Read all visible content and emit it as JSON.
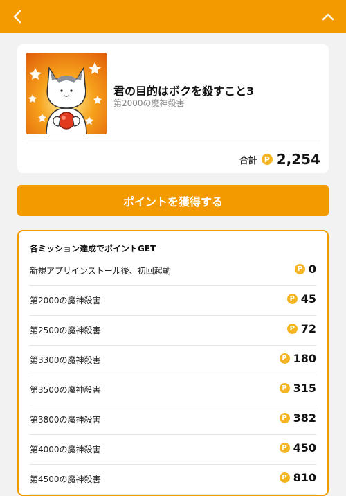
{
  "header": {
    "back_icon": "chevron-left-icon",
    "collapse_icon": "chevron-up-icon",
    "color": "#f39a00"
  },
  "app": {
    "title": "君の目的はボクを殺すこと3",
    "subtitle": "第2000の魔神殺害",
    "total_label": "合計",
    "total_value": "2,254",
    "coin_symbol": "P"
  },
  "cta": {
    "label": "ポイントを獲得する"
  },
  "missions": {
    "heading": "各ミッション達成でポイントGET",
    "items": [
      {
        "label": "新規アプリインストール後、初回起動",
        "points": "0"
      },
      {
        "label": "第2000の魔神殺害",
        "points": "45"
      },
      {
        "label": "第2500の魔神殺害",
        "points": "72"
      },
      {
        "label": "第3300の魔神殺害",
        "points": "180"
      },
      {
        "label": "第3500の魔神殺害",
        "points": "315"
      },
      {
        "label": "第3800の魔神殺害",
        "points": "382"
      },
      {
        "label": "第4000の魔神殺害",
        "points": "450"
      },
      {
        "label": "第4500の魔神殺害",
        "points": "810"
      }
    ]
  },
  "colors": {
    "accent": "#f39a00",
    "coin": "#f5b522",
    "background": "#f2f2f2"
  }
}
